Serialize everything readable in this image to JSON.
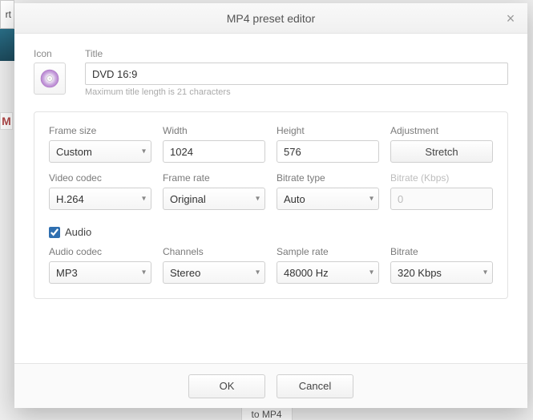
{
  "backdrop": {
    "tab": "rt",
    "red": "M",
    "footer": "to MP4"
  },
  "modal": {
    "title": "MP4 preset editor",
    "icon_label": "Icon",
    "title_label": "Title",
    "title_value": "DVD 16:9",
    "title_hint": "Maximum title length is 21 characters"
  },
  "video": {
    "frame_size": {
      "label": "Frame size",
      "value": "Custom"
    },
    "width": {
      "label": "Width",
      "value": "1024"
    },
    "height": {
      "label": "Height",
      "value": "576"
    },
    "adjustment": {
      "label": "Adjustment",
      "button": "Stretch"
    },
    "codec": {
      "label": "Video codec",
      "value": "H.264"
    },
    "frame_rate": {
      "label": "Frame rate",
      "value": "Original"
    },
    "bitrate_type": {
      "label": "Bitrate type",
      "value": "Auto"
    },
    "bitrate": {
      "label": "Bitrate (Kbps)",
      "value": "0"
    }
  },
  "audio": {
    "checkbox_label": "Audio",
    "checked": true,
    "codec": {
      "label": "Audio codec",
      "value": "MP3"
    },
    "channels": {
      "label": "Channels",
      "value": "Stereo"
    },
    "sample": {
      "label": "Sample rate",
      "value": "48000 Hz"
    },
    "bitrate": {
      "label": "Bitrate",
      "value": "320 Kbps"
    }
  },
  "footer": {
    "ok": "OK",
    "cancel": "Cancel"
  }
}
